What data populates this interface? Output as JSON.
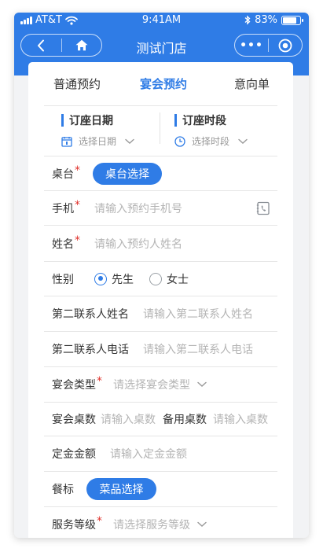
{
  "status_bar": {
    "carrier": "AT&T",
    "time": "9:41AM",
    "battery": "83%",
    "battery_level": 0.83
  },
  "nav": {
    "title": "测试门店",
    "more": "•••"
  },
  "tabs": [
    {
      "label": "普通预约",
      "active": false
    },
    {
      "label": "宴会预约",
      "active": true
    },
    {
      "label": "意向单",
      "active": false
    }
  ],
  "date_picker": {
    "date_label": "订座日期",
    "date_placeholder": "选择日期",
    "time_label": "订座时段",
    "time_placeholder": "选择时段"
  },
  "form": {
    "table": {
      "label": "桌台",
      "required": "*",
      "button": "桌台选择"
    },
    "phone": {
      "label": "手机",
      "required": "*",
      "placeholder": "请输入预约手机号"
    },
    "name": {
      "label": "姓名",
      "required": "*",
      "placeholder": "请输入预约人姓名"
    },
    "gender": {
      "label": "性别",
      "options": [
        "先生",
        "女士"
      ],
      "selected": "先生"
    },
    "second_contact_name": {
      "label": "第二联系人姓名",
      "placeholder": "请输入第二联系人姓名"
    },
    "second_contact_phone": {
      "label": "第二联系人电话",
      "placeholder": "请输入第二联系人电话"
    },
    "banquet_type": {
      "label": "宴会类型",
      "required": "*",
      "placeholder": "请选择宴会类型"
    },
    "table_count": {
      "label": "宴会桌数",
      "placeholder": "请输入桌数"
    },
    "spare_count": {
      "label": "备用桌数",
      "placeholder": "请输入桌数"
    },
    "deposit": {
      "label": "定金金额",
      "placeholder": "请输入定金金额"
    },
    "menu_standard": {
      "label": "餐标",
      "button": "菜品选择"
    },
    "service_level": {
      "label": "服务等级",
      "required": "*",
      "placeholder": "请选择服务等级"
    }
  },
  "colors": {
    "primary": "#2f7ce6",
    "required": "#e0312b",
    "placeholder": "#b4b4b4"
  }
}
